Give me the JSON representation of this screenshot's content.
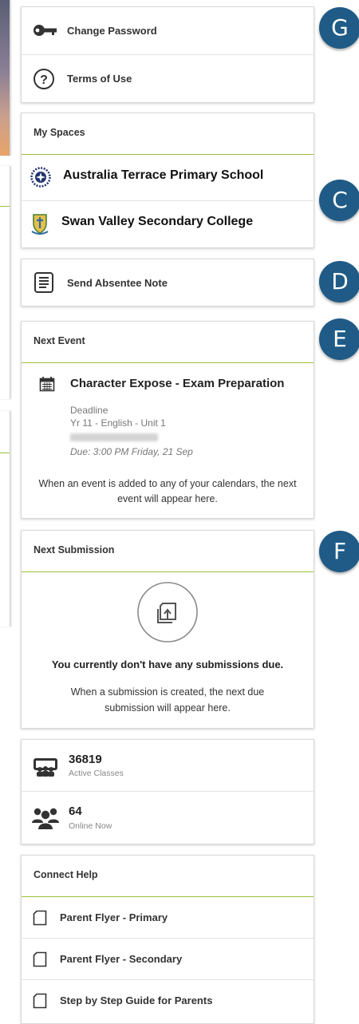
{
  "badges": {
    "g": "G",
    "c": "C",
    "d": "D",
    "e": "E",
    "f": "F"
  },
  "account": {
    "change_password": "Change Password",
    "terms": "Terms of Use"
  },
  "my_spaces": {
    "title": "My Spaces",
    "items": [
      {
        "name": "Australia Terrace Primary School",
        "icon": "school-crest-icon"
      },
      {
        "name": "Swan Valley Secondary College",
        "icon": "school-crest-icon"
      }
    ]
  },
  "absentee": {
    "label": "Send Absentee Note"
  },
  "next_event": {
    "title": "Next Event",
    "event_title": "Character Expose - Exam Preparation",
    "type": "Deadline",
    "class": "Yr 11 - English - Unit 1",
    "due": "Due: 3:00 PM Friday, 21 Sep",
    "note": "When an event is added to any of your calendars, the next event will appear here."
  },
  "next_submission": {
    "title": "Next Submission",
    "empty_heading": "You currently don't have any submissions due.",
    "empty_note": "When a submission is created, the next due submission will appear here."
  },
  "stats": [
    {
      "value": "36819",
      "label": "Active Classes",
      "icon": "classroom-icon"
    },
    {
      "value": "64",
      "label": "Online Now",
      "icon": "users-group-icon"
    }
  ],
  "connect_help": {
    "title": "Connect Help",
    "items": [
      "Parent Flyer - Primary",
      "Parent Flyer - Secondary",
      "Step by Step Guide for Parents"
    ]
  },
  "colors": {
    "accent_green": "#9dc23b",
    "badge_blue": "#1f5b86"
  }
}
